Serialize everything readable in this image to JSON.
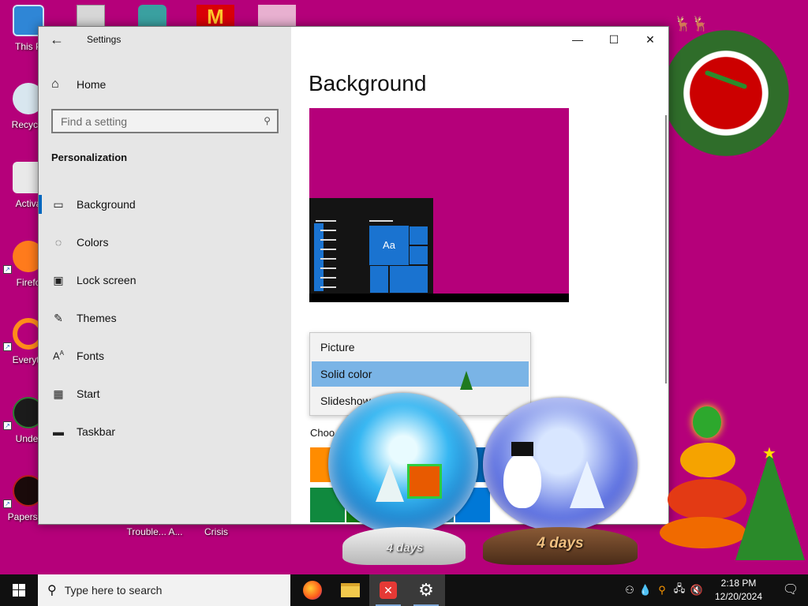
{
  "desktop": {
    "icons": [
      {
        "label": "This P"
      },
      {
        "label": "Recycle"
      },
      {
        "label": "Activa"
      },
      {
        "label": "Firefo"
      },
      {
        "label": "Everyth"
      },
      {
        "label": "Under"
      },
      {
        "label": "Papers, P"
      },
      {
        "label": "Trouble... A..."
      },
      {
        "label": "Crisis"
      }
    ]
  },
  "window": {
    "title": "Settings",
    "controls": {
      "minimize": "—",
      "maximize": "☐",
      "close": "✕"
    },
    "home_label": "Home",
    "search_placeholder": "Find a setting",
    "section_heading": "Personalization",
    "nav": [
      {
        "label": "Background",
        "icon": "picture-icon"
      },
      {
        "label": "Colors",
        "icon": "palette-icon"
      },
      {
        "label": "Lock screen",
        "icon": "lock-screen-icon"
      },
      {
        "label": "Themes",
        "icon": "brush-icon"
      },
      {
        "label": "Fonts",
        "icon": "font-icon"
      },
      {
        "label": "Start",
        "icon": "start-icon"
      },
      {
        "label": "Taskbar",
        "icon": "taskbar-icon"
      }
    ],
    "page_title": "Background",
    "preview_sample_text": "Aa",
    "background_options": [
      "Picture",
      "Solid color",
      "Slideshow"
    ],
    "selected_option": "Solid color",
    "choose_label": "Choo",
    "accent_color": "#0067c0",
    "background_color": "#b5007a",
    "swatches": [
      "#ff8c00",
      "#e81123",
      "#d13438",
      "#c30052",
      "#0063b1",
      "#10893e",
      "#107c10",
      "#018574",
      "#2d7d9a",
      "#0078d7"
    ]
  },
  "decorations": {
    "globe_left_text": "4 days",
    "globe_right_text": "4 days"
  },
  "taskbar": {
    "search_placeholder": "Type here to search",
    "apps": [
      {
        "name": "firefox-icon"
      },
      {
        "name": "file-explorer-icon"
      },
      {
        "name": "close-app-icon"
      },
      {
        "name": "settings-gear-icon"
      }
    ],
    "time": "2:18 PM",
    "date": "12/20/2024"
  }
}
